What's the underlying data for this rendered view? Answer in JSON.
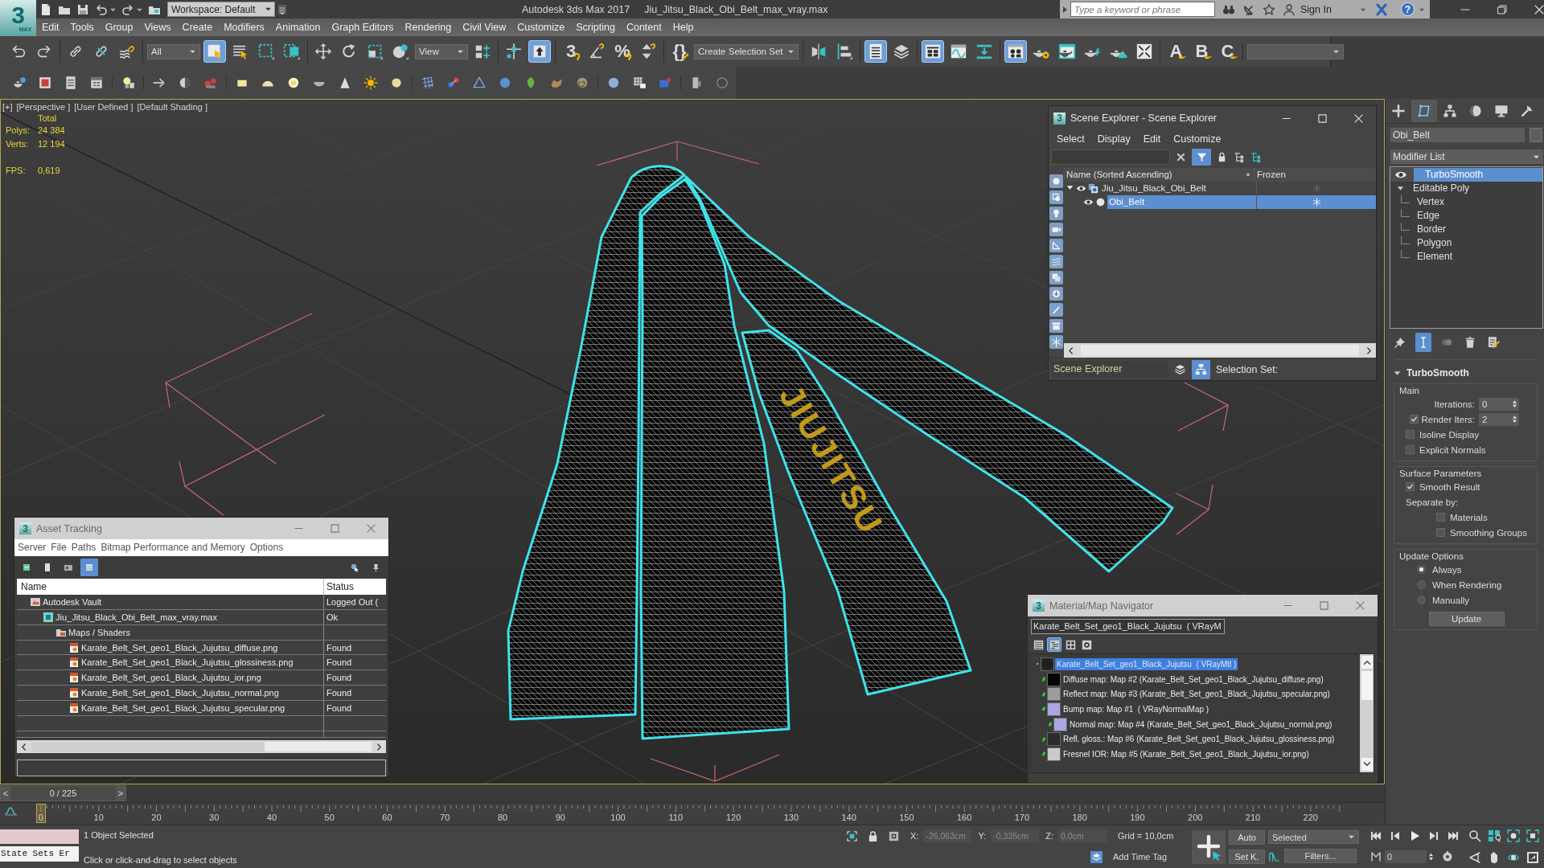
{
  "app": {
    "logo": "3",
    "logo_sub": "MAX",
    "workspace": "Workspace: Default",
    "title": "Autodesk 3ds Max 2017",
    "file": "Jiu_Jitsu_Black_Obi_Belt_max_vray.max",
    "search_placeholder": "Type a keyword or phrase",
    "sign_in": "Sign In",
    "help": "?"
  },
  "menu": [
    "Edit",
    "Tools",
    "Group",
    "Views",
    "Create",
    "Modifiers",
    "Animation",
    "Graph Editors",
    "Rendering",
    "Civil View",
    "Customize",
    "Scripting",
    "Content",
    "Help"
  ],
  "main_toolbar": [
    [
      {
        "kind": "undo",
        "selected": false
      },
      {
        "kind": "redo",
        "selected": false
      }
    ],
    [
      {
        "kind": "link",
        "selected": false
      },
      {
        "kind": "unlink",
        "selected": false
      },
      {
        "kind": "bind",
        "selected": false
      }
    ],
    [
      {
        "kind": "dropdown",
        "value": "All"
      },
      {
        "kind": "select",
        "selected": true
      },
      {
        "kind": "select_name",
        "selected": false
      },
      {
        "kind": "rect_region",
        "selected": false
      },
      {
        "kind": "crossing",
        "selected": false
      }
    ],
    [
      {
        "kind": "move",
        "selected": false
      },
      {
        "kind": "rotate",
        "selected": false
      },
      {
        "kind": "scale",
        "selected": false
      },
      {
        "kind": "place",
        "selected": false
      },
      {
        "kind": "dropdown",
        "value": "View"
      },
      {
        "kind": "pivot",
        "selected": false
      }
    ],
    [
      {
        "kind": "manipulate",
        "selected": false
      },
      {
        "kind": "keyboard",
        "selected": true
      }
    ],
    [
      {
        "kind": "snap",
        "glyph": "3",
        "selected": false
      },
      {
        "kind": "angle",
        "selected": false
      },
      {
        "kind": "snap",
        "glyph": "%",
        "selected": false
      },
      {
        "kind": "spinner",
        "selected": false
      }
    ],
    [
      {
        "kind": "named",
        "glyph": "{}",
        "selected": false
      },
      {
        "kind": "dropdown",
        "value": "Create Selection Set"
      }
    ],
    [
      {
        "kind": "mirror",
        "selected": false
      },
      {
        "kind": "align",
        "selected": false
      }
    ],
    [
      {
        "kind": "explorer",
        "selected": true
      },
      {
        "kind": "layers",
        "selected": false
      }
    ],
    [
      {
        "kind": "ribbon",
        "selected": true
      },
      {
        "kind": "curve",
        "selected": false
      },
      {
        "kind": "dope",
        "selected": false
      }
    ],
    [
      {
        "kind": "material",
        "selected": true
      },
      {
        "kind": "render_setup",
        "selected": false
      },
      {
        "kind": "frame_window",
        "selected": false
      },
      {
        "kind": "render",
        "selected": false
      },
      {
        "kind": "cloud",
        "selected": false
      },
      {
        "kind": "gallery",
        "selected": false
      }
    ],
    [
      {
        "kind": "state",
        "glyph": "A",
        "selected": false
      },
      {
        "kind": "state",
        "glyph": "B",
        "selected": false
      },
      {
        "kind": "state",
        "glyph": "C",
        "selected": false
      }
    ],
    [
      {
        "kind": "dropdown"
      }
    ]
  ],
  "viewport": {
    "labels": [
      "[+]",
      "[Perspective ]",
      "[User Defined ]",
      "[Default Shading ]"
    ],
    "stats": {
      "header": "Total",
      "counts": [
        {
          "label": "Polys:",
          "value": "24 384"
        },
        {
          "label": "Verts:",
          "value": "12 194"
        }
      ],
      "fps": {
        "label": "FPS:",
        "value": "0,619"
      }
    },
    "belt_print": "JIUJITSU"
  },
  "scene_explorer": {
    "app_icon": "3",
    "title": "Scene Explorer - Scene Explorer",
    "menu": [
      "Select",
      "Display",
      "Edit",
      "Customize"
    ],
    "filter_selected": true,
    "columns": [
      "Name (Sorted Ascending)",
      "Frozen"
    ],
    "rows": [
      {
        "kind": "group",
        "name": "Jiu_Jitsu_Black_Obi_Belt",
        "selected": false,
        "expanded": true,
        "children": [
          {
            "kind": "object",
            "name": "Obi_Belt",
            "selected": true
          }
        ]
      }
    ],
    "explorer": "Scene Explorer",
    "hierarchy_selected": true,
    "selection_set": "Selection Set:"
  },
  "asset_tracking": {
    "app_icon": "3",
    "title": "Asset Tracking",
    "menu": [
      "Server",
      "File",
      "Paths",
      "Bitmap Performance and Memory",
      "Options"
    ],
    "tools": [
      {
        "kind": "refresh",
        "selected": false
      },
      {
        "kind": "page",
        "selected": false
      },
      {
        "kind": "thumb",
        "selected": false
      },
      {
        "kind": "table",
        "selected": true
      },
      {
        "kind": "help",
        "selected": false
      },
      {
        "kind": "pin",
        "selected": false
      }
    ],
    "columns": [
      "Name",
      "Status"
    ],
    "rows": [
      {
        "kind": "vault",
        "name": "Autodesk Vault",
        "status": "Logged Out (",
        "children": [
          {
            "kind": "scene",
            "name": "Jiu_Jitsu_Black_Obi_Belt_max_vray.max",
            "status": "Ok",
            "children": [
              {
                "kind": "folder",
                "name": "Maps / Shaders",
                "children": [
                  {
                    "kind": "image",
                    "name": "Karate_Belt_Set_geo1_Black_Jujutsu_diffuse.png",
                    "status": "Found"
                  },
                  {
                    "kind": "image",
                    "name": "Karate_Belt_Set_geo1_Black_Jujutsu_glossiness.png",
                    "status": "Found"
                  },
                  {
                    "kind": "image",
                    "name": "Karate_Belt_Set_geo1_Black_Jujutsu_ior.png",
                    "status": "Found"
                  },
                  {
                    "kind": "image",
                    "name": "Karate_Belt_Set_geo1_Black_Jujutsu_normal.png",
                    "status": "Found"
                  },
                  {
                    "kind": "image",
                    "name": "Karate_Belt_Set_geo1_Black_Jujutsu_specular.png",
                    "status": "Found"
                  }
                ]
              }
            ]
          }
        ]
      }
    ]
  },
  "material_navigator": {
    "app_icon": "3",
    "title": "Material/Map Navigator",
    "name_field": "Karate_Belt_Set_geo1_Black_Jujutsu  ( VRayM",
    "views": [
      {
        "kind": "list",
        "selected": false
      },
      {
        "kind": "tree",
        "selected": true
      },
      {
        "kind": "grid",
        "selected": false
      },
      {
        "kind": "small",
        "selected": false
      }
    ],
    "tree": [
      {
        "name": "Karate_Belt_Set_geo1_Black_Jujutsu  ( VRayMtl )",
        "selected": true,
        "color": "#1e1e1e",
        "children": [
          {
            "name": "Diffuse map: Map #2 (Karate_Belt_Set_geo1_Black_Jujutsu_diffuse.png)",
            "selected": false,
            "color": "#050505"
          },
          {
            "name": "Reflect map: Map #3 (Karate_Belt_Set_geo1_Black_Jujutsu_specular.png)",
            "selected": false,
            "color": "#9c9c9c"
          },
          {
            "name": "Bump map: Map #1  ( VRayNormalMap )",
            "selected": false,
            "color": "#aaa6e4",
            "children": [
              {
                "name": "Normal map: Map #4 (Karate_Belt_Set_geo1_Black_Jujutsu_normal.png)",
                "selected": false,
                "color": "#aaa6e4"
              }
            ]
          },
          {
            "name": "Refl. gloss.: Map #6 (Karate_Belt_Set_geo1_Black_Jujutsu_glossiness.png)",
            "selected": false,
            "color": "#2c2c2c"
          },
          {
            "name": "Fresnel IOR: Map #5 (Karate_Belt_Set_geo1_Black_Jujutsu_ior.png)",
            "selected": false,
            "color": "#cacaca"
          }
        ]
      }
    ]
  },
  "command_panel": {
    "tabs": [
      {
        "kind": "create",
        "selected": false
      },
      {
        "kind": "modify",
        "selected": true
      },
      {
        "kind": "hierarchy",
        "selected": false
      },
      {
        "kind": "motion",
        "selected": false
      },
      {
        "kind": "display",
        "selected": false
      },
      {
        "kind": "utilities",
        "selected": false
      }
    ],
    "object_name": "Obi_Belt",
    "modifier_list": "Modifier List",
    "stack": [
      {
        "kind": "modifier",
        "name": "TurboSmooth",
        "selected": true,
        "enabled": true
      },
      {
        "kind": "object",
        "name": "Editable Poly",
        "selected": false,
        "expanded": true,
        "children": [
          {
            "name": "Vertex",
            "selected": false
          },
          {
            "name": "Edge",
            "selected": false
          },
          {
            "name": "Border",
            "selected": false
          },
          {
            "name": "Polygon",
            "selected": false
          },
          {
            "name": "Element",
            "selected": false
          }
        ]
      }
    ],
    "stack_tools": [
      {
        "kind": "pin",
        "selected": false
      },
      {
        "kind": "end_result",
        "selected": true
      },
      {
        "kind": "unique",
        "selected": false
      },
      {
        "kind": "remove",
        "selected": false
      },
      {
        "kind": "configure",
        "selected": false
      }
    ],
    "rollout": {
      "title": "TurboSmooth",
      "expanded": true,
      "groups": [
        {
          "title": "Main",
          "controls": [
            {
              "kind": "spinner",
              "label": "Iterations:",
              "value": "0"
            },
            {
              "kind": "check_spinner",
              "label": "Render Iters:",
              "checked": true,
              "value": "2"
            },
            {
              "kind": "checkbox",
              "label": "Isoline Display",
              "checked": false
            },
            {
              "kind": "checkbox",
              "label": "Explicit Normals",
              "checked": false
            }
          ]
        },
        {
          "title": "Surface Parameters",
          "controls": [
            {
              "kind": "checkbox",
              "label": "Smooth Result",
              "checked": true
            },
            {
              "kind": "label",
              "label": "Separate by:"
            },
            {
              "kind": "sub_checkbox",
              "label": "Materials",
              "checked": false
            },
            {
              "kind": "sub_checkbox",
              "label": "Smoothing Groups",
              "checked": false
            }
          ]
        },
        {
          "title": "Update Options",
          "controls": [
            {
              "kind": "radio",
              "label": "Always",
              "selected": true
            },
            {
              "kind": "radio",
              "label": "When Rendering",
              "selected": false
            },
            {
              "kind": "radio",
              "label": "Manually",
              "selected": false
            },
            {
              "kind": "button",
              "label": "Update"
            }
          ]
        }
      ]
    }
  },
  "time_slider": {
    "prev": "<",
    "reading": "0 / 225",
    "next": ">",
    "level": 0
  },
  "trackbar": {
    "ticks": [
      "0",
      "10",
      "20",
      "30",
      "40",
      "50",
      "60",
      "70",
      "80",
      "90",
      "100",
      "110",
      "120",
      "130",
      "140",
      "150",
      "160",
      "170",
      "180",
      "190",
      "200",
      "210",
      "220"
    ]
  },
  "status_bar": {
    "listener": "State Sets Er",
    "selection": "1 Object Selected",
    "prompt": "Click or click-and-drag to select objects",
    "coords": [
      {
        "axis": "X:",
        "value": "-26,063cm",
        "disabled": true
      },
      {
        "axis": "Y:",
        "value": "-0,335cm",
        "disabled": true
      },
      {
        "axis": "Z:",
        "value": "0,0cm",
        "disabled": true
      }
    ],
    "grid": "Grid = 10,0cm",
    "time_tag": "Add Time Tag",
    "auto_key": {
      "label": "Auto",
      "selected": false
    },
    "set_key": "Set K.",
    "key_set": "Selected",
    "filters": "Filters...",
    "frame": "0"
  }
}
